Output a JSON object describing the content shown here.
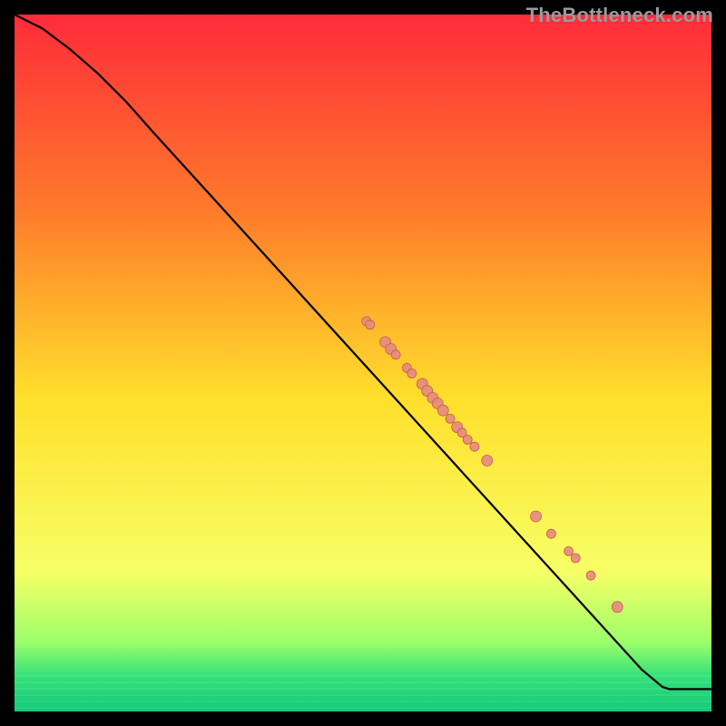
{
  "watermark": "TheBottleneck.com",
  "colors": {
    "background": "#000000",
    "grad_top": "#ff2b3a",
    "grad_mid_top": "#ff7a2b",
    "grad_mid": "#ffdf2b",
    "grad_mid_bot": "#f7ff66",
    "grad_green1": "#9cff6a",
    "grad_green2": "#34e07a",
    "grad_green3": "#14c97a",
    "curve": "#000000",
    "dot_fill": "#e58b80",
    "dot_stroke": "#c85b4f"
  },
  "chart_data": {
    "type": "line",
    "title": "",
    "xlabel": "",
    "ylabel": "",
    "xlim": [
      0,
      100
    ],
    "ylim": [
      0,
      100
    ],
    "curve": [
      {
        "x": 0,
        "y": 100
      },
      {
        "x": 4,
        "y": 98
      },
      {
        "x": 8,
        "y": 95
      },
      {
        "x": 12,
        "y": 91.5
      },
      {
        "x": 16,
        "y": 87.5
      },
      {
        "x": 20,
        "y": 83
      },
      {
        "x": 30,
        "y": 72
      },
      {
        "x": 40,
        "y": 61
      },
      {
        "x": 50,
        "y": 50
      },
      {
        "x": 60,
        "y": 39
      },
      {
        "x": 70,
        "y": 28
      },
      {
        "x": 80,
        "y": 17
      },
      {
        "x": 90,
        "y": 6
      },
      {
        "x": 93,
        "y": 3.5
      },
      {
        "x": 94,
        "y": 3.2
      },
      {
        "x": 100,
        "y": 3.2
      }
    ],
    "dots": [
      {
        "x": 50.5,
        "y": 56.0,
        "r": 5
      },
      {
        "x": 51.0,
        "y": 55.5,
        "r": 5
      },
      {
        "x": 53.2,
        "y": 53.0,
        "r": 6
      },
      {
        "x": 54.0,
        "y": 52.0,
        "r": 6
      },
      {
        "x": 54.7,
        "y": 51.2,
        "r": 5
      },
      {
        "x": 56.3,
        "y": 49.3,
        "r": 5
      },
      {
        "x": 57.0,
        "y": 48.5,
        "r": 5
      },
      {
        "x": 58.5,
        "y": 47.0,
        "r": 6
      },
      {
        "x": 59.2,
        "y": 46.0,
        "r": 6
      },
      {
        "x": 60.0,
        "y": 45.0,
        "r": 6
      },
      {
        "x": 60.7,
        "y": 44.2,
        "r": 6
      },
      {
        "x": 61.5,
        "y": 43.2,
        "r": 6
      },
      {
        "x": 62.5,
        "y": 42.0,
        "r": 5
      },
      {
        "x": 63.5,
        "y": 40.8,
        "r": 6
      },
      {
        "x": 64.2,
        "y": 40.0,
        "r": 5
      },
      {
        "x": 65.0,
        "y": 39.0,
        "r": 5
      },
      {
        "x": 66.0,
        "y": 38.0,
        "r": 5
      },
      {
        "x": 67.8,
        "y": 36.0,
        "r": 6
      },
      {
        "x": 74.8,
        "y": 28.0,
        "r": 6
      },
      {
        "x": 77.0,
        "y": 25.5,
        "r": 5
      },
      {
        "x": 79.5,
        "y": 23.0,
        "r": 5
      },
      {
        "x": 80.5,
        "y": 22.0,
        "r": 5
      },
      {
        "x": 82.7,
        "y": 19.5,
        "r": 5
      },
      {
        "x": 86.5,
        "y": 15.0,
        "r": 6
      }
    ]
  }
}
